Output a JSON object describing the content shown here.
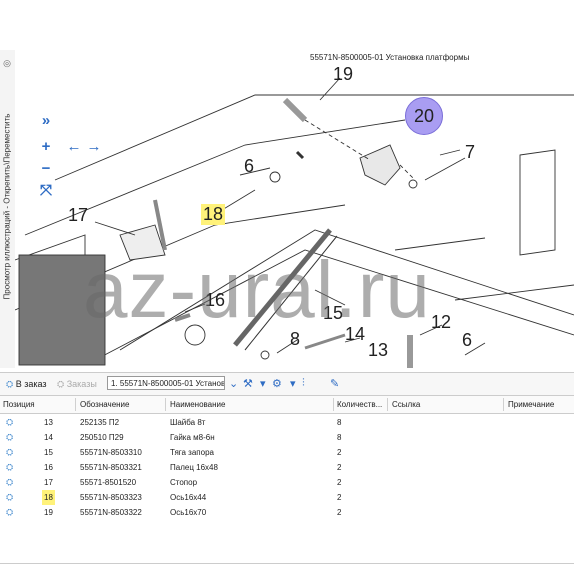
{
  "side_tab": {
    "label": "Просмотр иллюстраций - Открепить\\Переместить"
  },
  "viewer": {
    "title": "55571N-8500005-01 Установка платформы",
    "watermark": "az-ural.ru",
    "tools": [
      "double-chevron-right-icon",
      "zoom-in-icon",
      "arrow-left-icon",
      "arrow-right-icon",
      "zoom-out-icon",
      "fit-screen-icon"
    ],
    "callouts": {
      "c19": "19",
      "c20": "20",
      "c6a": "6",
      "c7": "7",
      "c17": "17",
      "c18": "18",
      "c16": "16",
      "c15": "15",
      "c8": "8",
      "c14": "14",
      "c12": "12",
      "c13": "13",
      "c6b": "6"
    },
    "highlight_color": "#fff27a",
    "selected_callout_color": "#a99df2"
  },
  "toolbar": {
    "order_label": "В заказ",
    "orders_label": "Заказы",
    "document_select": "1. 55571N-8500005-01 Установ"
  },
  "table": {
    "columns": [
      "Позиция",
      "Обозначение",
      "Наименование",
      "Количеств...",
      "Ссылка",
      "Примечание"
    ],
    "rows": [
      {
        "pos": "13",
        "code": "252135 П2",
        "name": "Шайба 8т",
        "qty": "8"
      },
      {
        "pos": "14",
        "code": "250510 П29",
        "name": "Гайка м8-6н",
        "qty": "8"
      },
      {
        "pos": "15",
        "code": "55571N-8503310",
        "name": "Тяга запора",
        "qty": "2"
      },
      {
        "pos": "16",
        "code": "55571N-8503321",
        "name": "Палец 16х48",
        "qty": "2"
      },
      {
        "pos": "17",
        "code": "55571-8501520",
        "name": "Стопор",
        "qty": "2"
      },
      {
        "pos": "18",
        "code": "55571N-8503323",
        "name": "Ось16х44",
        "qty": "2"
      },
      {
        "pos": "19",
        "code": "55571N-8503322",
        "name": "Ось16х70",
        "qty": "2"
      }
    ]
  }
}
